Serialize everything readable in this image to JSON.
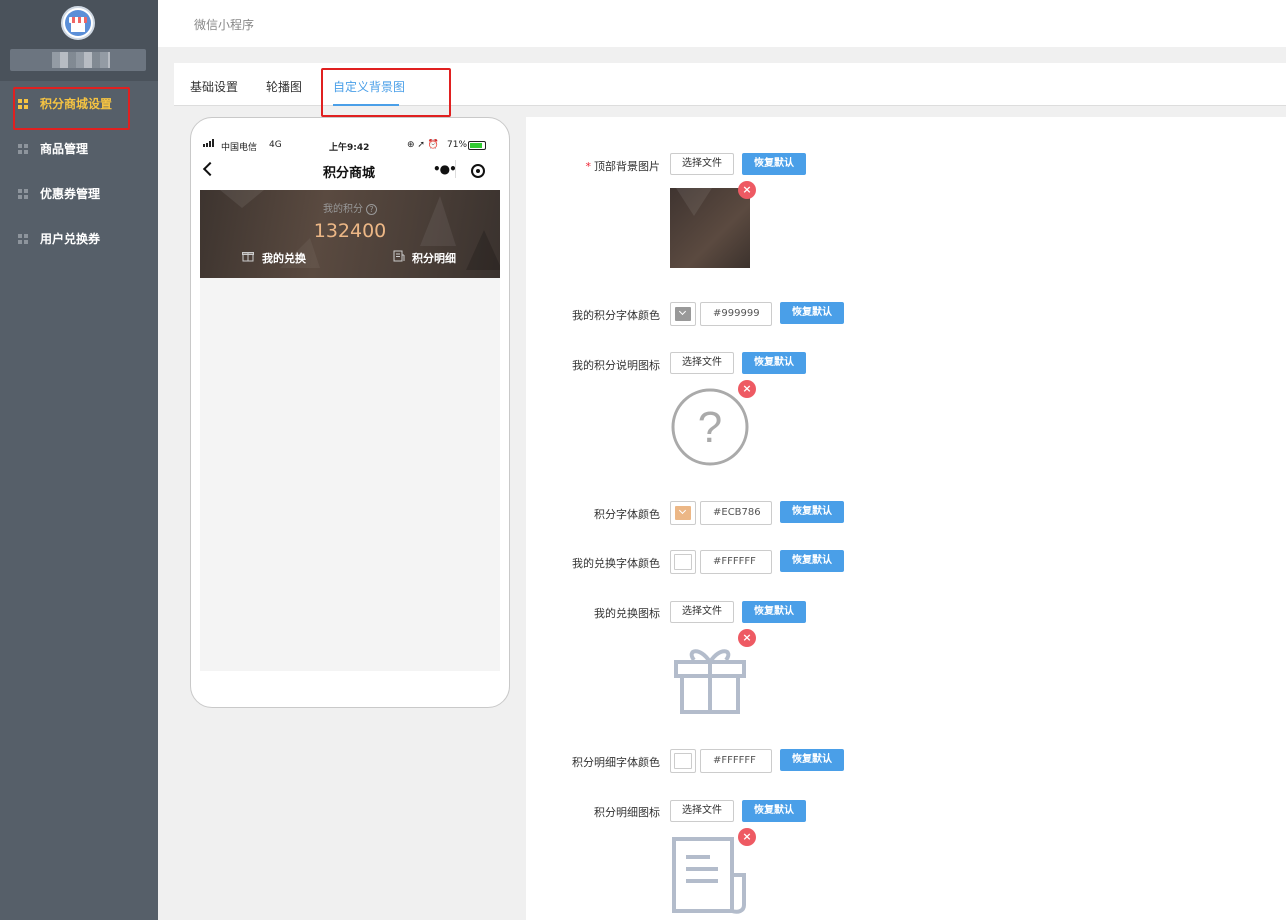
{
  "sidebar": {
    "items": [
      {
        "label": "积分商城设置",
        "active": true
      },
      {
        "label": "商品管理"
      },
      {
        "label": "优惠券管理"
      },
      {
        "label": "用户兑换券"
      }
    ]
  },
  "header": {
    "breadcrumb": "微信小程序"
  },
  "tabs": [
    {
      "label": "基础设置"
    },
    {
      "label": "轮播图"
    },
    {
      "label": "自定义背景图",
      "active": true
    }
  ],
  "phone": {
    "status": {
      "carrier": "中国电信",
      "network": "4G",
      "time": "上午9:42",
      "battery": "71%"
    },
    "title": "积分商城",
    "banner": {
      "label": "我的积分",
      "points": "132400",
      "exchange": "我的兑换",
      "detail": "积分明细"
    }
  },
  "form": {
    "rows": [
      {
        "label": "顶部背景图片",
        "required": true,
        "type": "file"
      },
      {
        "label": "我的积分字体颜色",
        "type": "color",
        "value": "#999999"
      },
      {
        "label": "我的积分说明图标",
        "type": "file"
      },
      {
        "label": "积分字体颜色",
        "type": "color",
        "value": "#ECB786"
      },
      {
        "label": "我的兑换字体颜色",
        "type": "color",
        "value": "#FFFFFF"
      },
      {
        "label": "我的兑换图标",
        "type": "file"
      },
      {
        "label": "积分明细字体颜色",
        "type": "color",
        "value": "#FFFFFF"
      },
      {
        "label": "积分明细图标",
        "type": "file"
      }
    ],
    "file_button": "选择文件",
    "reset_button": "恢复默认",
    "required_mark": "*",
    "delete_symbol": "×"
  },
  "colors": {
    "accent": "#4a9fe8",
    "sidebar": "#565f69",
    "active": "#f5c342",
    "danger": "#ee5a63"
  }
}
